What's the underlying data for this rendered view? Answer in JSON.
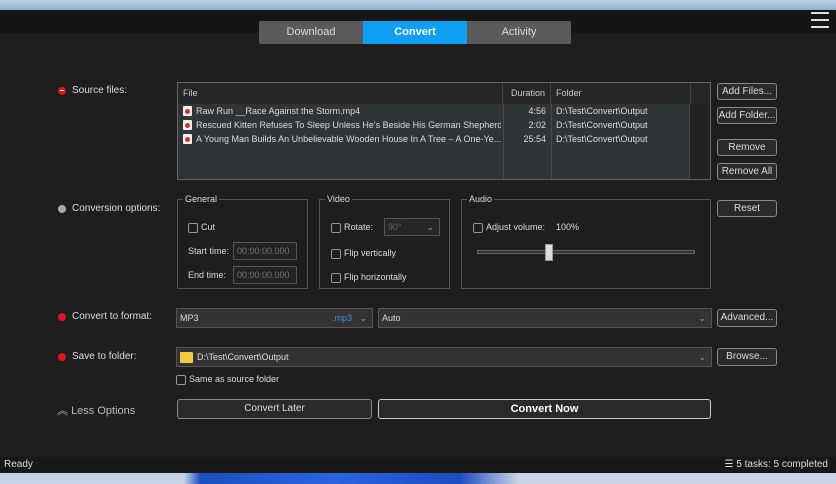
{
  "tabs": [
    "Download",
    "Convert",
    "Activity"
  ],
  "source": {
    "label": "Source files:",
    "columns": [
      "File",
      "Duration",
      "Folder"
    ],
    "rows": [
      {
        "file": "Raw Run __Race Against the Storm.mp4",
        "duration": "4:56",
        "folder": "D:\\Test\\Convert\\Output"
      },
      {
        "file": "Rescued Kitten Refuses To Sleep Unless He's Beside His German Shepherd....",
        "duration": "2:02",
        "folder": "D:\\Test\\Convert\\Output"
      },
      {
        "file": "A Young Man Builds An Unbelievable Wooden House In A Tree – A One-Ye...",
        "duration": "25:54",
        "folder": "D:\\Test\\Convert\\Output"
      }
    ],
    "buttons": {
      "add_files": "Add Files...",
      "add_folder": "Add Folder...",
      "remove": "Remove",
      "remove_all": "Remove All"
    }
  },
  "options": {
    "label": "Conversion options:",
    "general": "General",
    "cut": "Cut",
    "start_time": "Start time:",
    "end_time": "End time:",
    "time_placeholder": "00:00:00.000",
    "video": "Video",
    "rotate": "Rotate:",
    "rotate_value": "90°",
    "flip_v": "Flip vertically",
    "flip_h": "Flip horizontally",
    "audio": "Audio",
    "adjust_volume": "Adjust volume:",
    "volume_value": "100%",
    "volume_fraction": 0.33,
    "reset": "Reset"
  },
  "format": {
    "label": "Convert to format:",
    "value": "MP3",
    "ext": ".mp3",
    "quality": "Auto",
    "advanced": "Advanced..."
  },
  "save": {
    "label": "Save to folder:",
    "path": "D:\\Test\\Convert\\Output",
    "browse": "Browse...",
    "same_as_source": "Same as source folder"
  },
  "less_options": "Less Options",
  "convert_later": "Convert Later",
  "convert_now": "Convert Now",
  "status": {
    "left": "Ready",
    "right": "5 tasks: 5 completed"
  }
}
